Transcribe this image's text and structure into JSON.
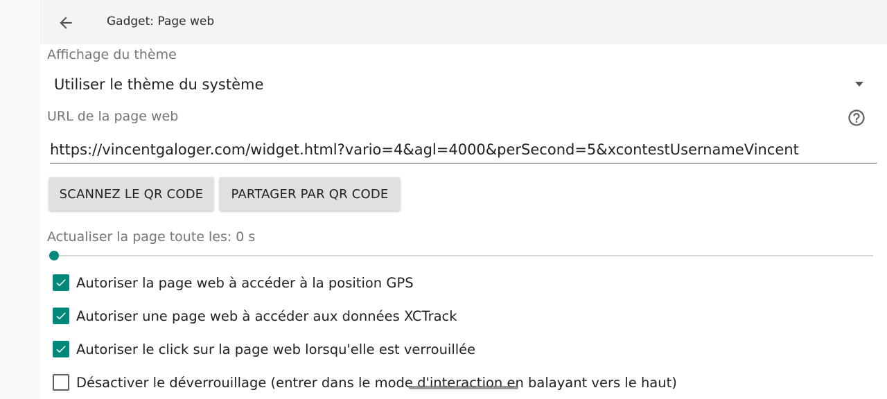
{
  "appbar": {
    "title": "Gadget: Page web",
    "back_icon": "arrow-left-icon"
  },
  "theme": {
    "label": "Affichage du thème",
    "selected": "Utiliser le thème du système",
    "caret_icon": "caret-down-icon"
  },
  "url": {
    "label": "URL de la page web",
    "value": "https://vincentgaloger.com/widget.html?vario=4&agl=4000&perSecond=5&xcontestUsernameVincent",
    "help_icon": "help-circle-icon"
  },
  "buttons": {
    "scan_label": "SCANNEZ LE QR CODE",
    "share_label": "PARTAGER PAR QR CODE"
  },
  "refresh": {
    "label": "Actualiser la page toute les: 0 s",
    "slider_fraction": 0.0
  },
  "options": [
    {
      "label": "Autoriser la page web à accéder à la position GPS",
      "checked": true
    },
    {
      "label": "Autoriser une page web à accéder aux données XCTrack",
      "checked": true
    },
    {
      "label": "Autoriser le click sur la page web lorsqu'elle est verrouillée",
      "checked": true
    },
    {
      "label": "Désactiver le déverrouillage (entrer dans le mode d'interaction en balayant vers le haut)",
      "checked": false
    }
  ],
  "colors": {
    "accent": "#00897b",
    "appbar_bg": "#f5f5f5",
    "button_bg": "#e0e0e0"
  }
}
